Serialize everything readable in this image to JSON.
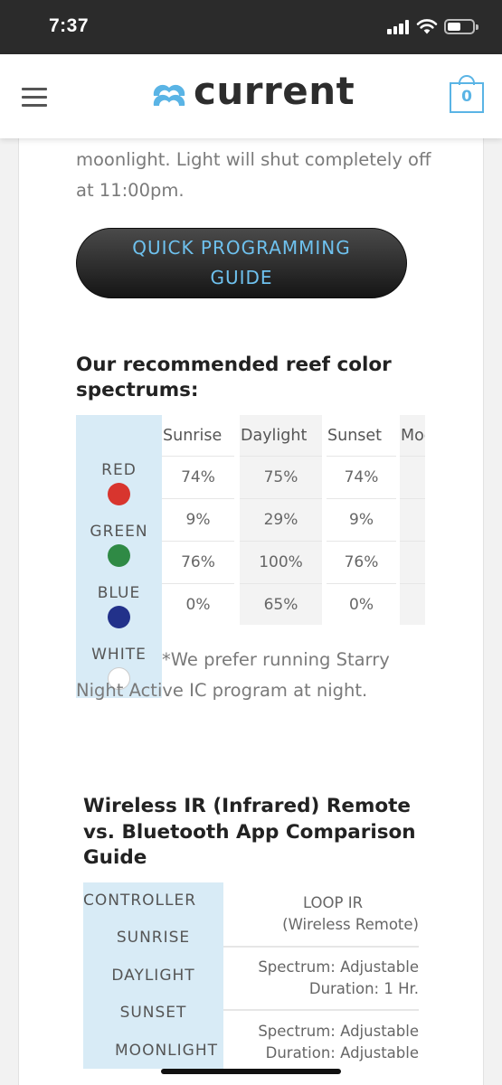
{
  "status_bar": {
    "time": "7:37"
  },
  "header": {
    "logo_text": "current",
    "cart_count": "0",
    "brand_color": "#5ab4e5"
  },
  "intro": {
    "text": "moonlight. Light will shut completely off at 11:00pm."
  },
  "guide_button": {
    "label": "QUICK PROGRAMMING GUIDE"
  },
  "spectrum_section": {
    "heading": "Our recommended reef color spectrums:",
    "colors": [
      {
        "label": "RED",
        "hex": "#d8352e"
      },
      {
        "label": "GREEN",
        "hex": "#2f8a45"
      },
      {
        "label": "BLUE",
        "hex": "#22318a"
      },
      {
        "label": "WHITE",
        "hex": "#ffffff"
      }
    ],
    "columns": [
      "Sunrise",
      "Daylight",
      "Sunset",
      "Moonlight"
    ],
    "rows": [
      [
        "74%",
        "75%",
        "74%",
        ""
      ],
      [
        "9%",
        "29%",
        "9%",
        ""
      ],
      [
        "76%",
        "100%",
        "76%",
        ""
      ],
      [
        "0%",
        "65%",
        "0%",
        ""
      ]
    ],
    "note": "*We prefer running Starry Night Active IC program at night."
  },
  "comparison_section": {
    "heading": "Wireless IR (Infrared) Remote vs. Bluetooth App Comparison Guide",
    "row_labels": [
      "CONTROLLER",
      "SUNRISE",
      "DAYLIGHT",
      "SUNSET",
      "MOONLIGHT"
    ],
    "column_header": [
      "LOOP IR",
      "(Wireless Remote)"
    ],
    "cells": [
      [
        "Spectrum: Adjustable",
        "Duration: 1 Hr."
      ],
      [
        "Spectrum: Adjustable",
        "Duration: Adjustable"
      ]
    ]
  }
}
